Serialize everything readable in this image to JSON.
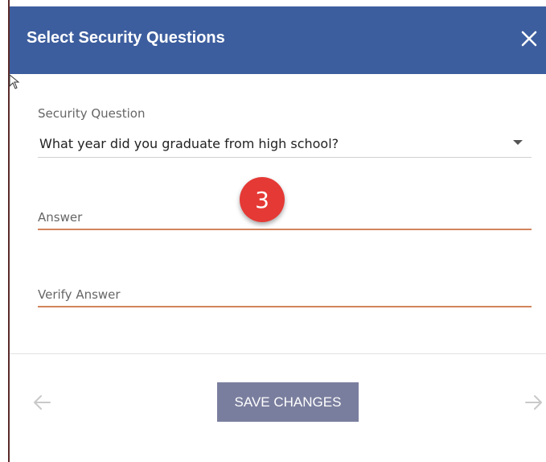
{
  "dialog": {
    "title": "Select Security Questions",
    "close_icon": "close-icon"
  },
  "form": {
    "question": {
      "label": "Security Question",
      "value": "What year did you graduate from high school?"
    },
    "answer": {
      "label": "Answer",
      "value": ""
    },
    "verify_answer": {
      "label": "Verify Answer",
      "value": ""
    }
  },
  "footer": {
    "save_label": "SAVE CHANGES",
    "prev_icon": "arrow-left-icon",
    "next_icon": "arrow-right-icon"
  },
  "annotation": {
    "step_number": "3"
  },
  "colors": {
    "header": "#3d5e9e",
    "input_underline": "#d2845c",
    "save_button": "#7a7e9e",
    "badge": "#e53935"
  }
}
